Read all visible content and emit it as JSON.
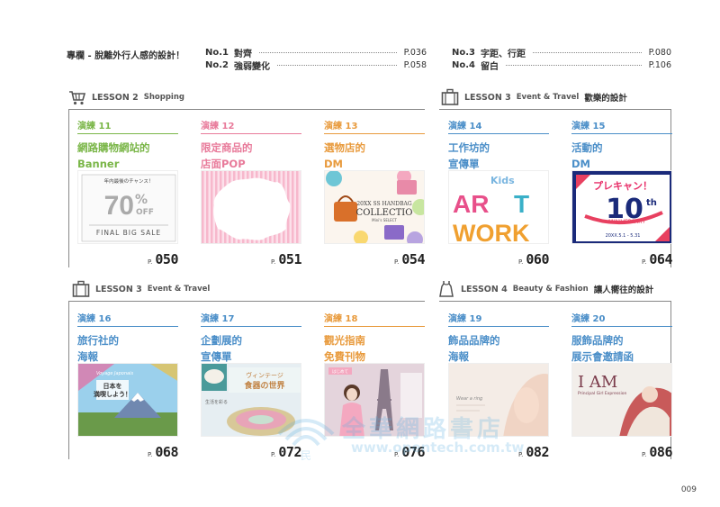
{
  "column_heading": "專欄 - 脫離外行人感的設計！",
  "columns": [
    {
      "no": "No.1",
      "title": "對齊",
      "page": "P.036"
    },
    {
      "no": "No.2",
      "title": "強弱變化",
      "page": "P.058"
    },
    {
      "no": "No.3",
      "title": "字距、行距",
      "page": "P.080"
    },
    {
      "no": "No.4",
      "title": "留白",
      "page": "P.106"
    }
  ],
  "lessons": [
    {
      "label": "LESSON 2",
      "sub": "Shopping",
      "zh": "",
      "icon": "shopping-cart-icon"
    },
    {
      "label": "LESSON 3",
      "sub": "Event & Travel",
      "zh": "歡樂的設計",
      "icon": "briefcase-icon"
    },
    {
      "label": "LESSON 3",
      "sub": "Event & Travel",
      "zh": "",
      "icon": "briefcase-icon"
    },
    {
      "label": "LESSON 4",
      "sub": "Beauty & Fashion",
      "zh": "讓人嚮往的設計",
      "icon": "dress-icon"
    }
  ],
  "cards": [
    {
      "num": "演練 11",
      "title1": "網路購物網站的",
      "title2": "Banner",
      "p": "P.",
      "page": "050"
    },
    {
      "num": "演練 12",
      "title1": "限定商品的",
      "title2": "店面POP",
      "p": "P.",
      "page": "051"
    },
    {
      "num": "演練 13",
      "title1": "選物店的",
      "title2": "DM",
      "p": "P.",
      "page": "054"
    },
    {
      "num": "演練 14",
      "title1": "工作坊的",
      "title2": "宣傳單",
      "p": "P.",
      "page": "060"
    },
    {
      "num": "演練 15",
      "title1": "活動的",
      "title2": "DM",
      "p": "P.",
      "page": "064"
    },
    {
      "num": "演練 16",
      "title1": "旅行社的",
      "title2": "海報",
      "p": "P.",
      "page": "068"
    },
    {
      "num": "演練 17",
      "title1": "企劃展的",
      "title2": "宣傳單",
      "p": "P.",
      "page": "072"
    },
    {
      "num": "演練 18",
      "title1": "觀光指南",
      "title2": "免費刊物",
      "p": "P.",
      "page": "076"
    },
    {
      "num": "演練 19",
      "title1": "飾品品牌的",
      "title2": "海報",
      "p": "P.",
      "page": "082"
    },
    {
      "num": "演練 20",
      "title1": "服飾品牌的",
      "title2": "展示會邀請函",
      "p": "P.",
      "page": "086"
    }
  ],
  "thumbs": {
    "sale_top": "年内最後のチャンス！",
    "sale_big": "70",
    "sale_pct": "%",
    "sale_off": "OFF",
    "sale_bottom": "FINAL BIG SALE",
    "dm_line1": "20XX SS HANDBAG",
    "dm_line2": "COLLECTIO",
    "dm_line3": "Mini's SELECT",
    "art_kids": "Kids",
    "art_a": "AR",
    "art_t": "T",
    "art_w": "WORK",
    "event_pre": "プレキャン！",
    "event_10": "10",
    "event_th": "th",
    "event_anni": "ANNIVERSARY",
    "event_date": "20XX.5.1 - 5.31",
    "travel_small": "Voyage Japonais",
    "travel_main1": "日本を",
    "travel_main2": "満喫しよう！",
    "exhib_main1": "ヴィンテージ",
    "exhib_main2": "食器の世界",
    "exhib_side": "生活を彩る",
    "guide_badge": "はじめて",
    "acc_text": "Wear a ring",
    "fashion_title": "I AM",
    "fashion_sub": "Principal Girl Expression"
  },
  "watermark": {
    "text": "全華網路書店",
    "url": "www.opentech.com.tw",
    "small": "民"
  },
  "folio": "009"
}
